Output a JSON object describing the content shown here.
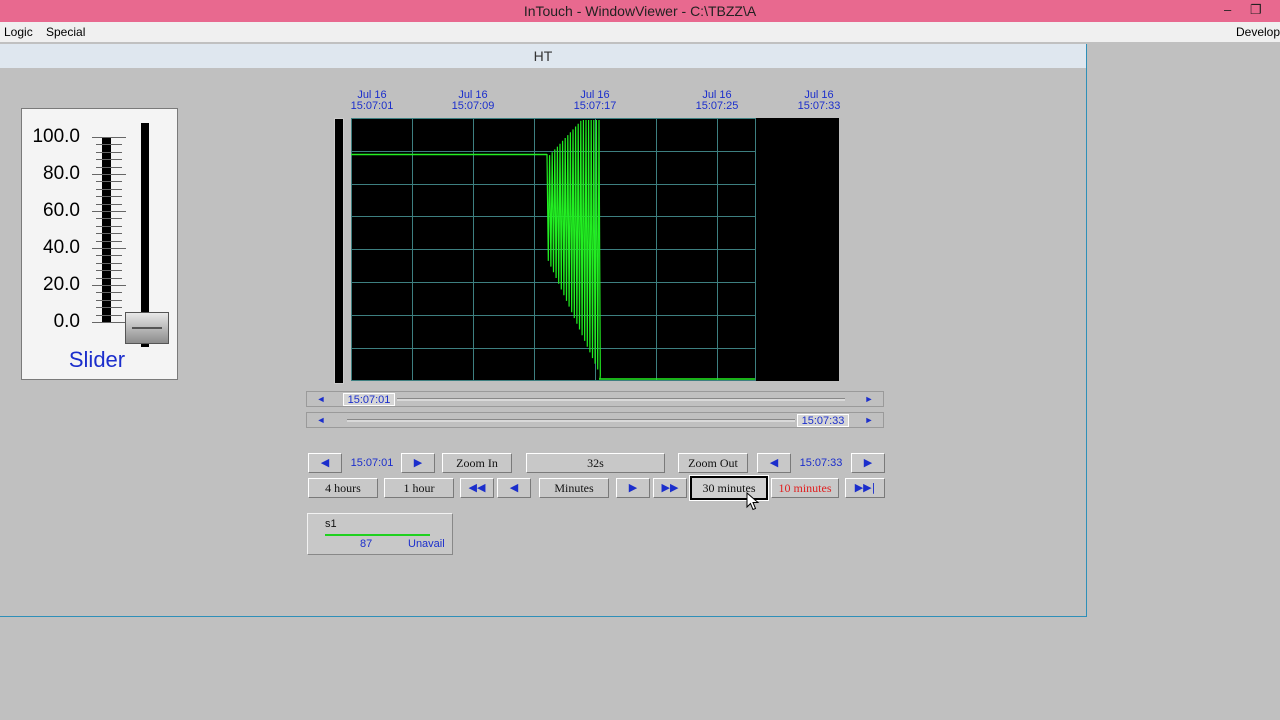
{
  "titlebar": {
    "title": "InTouch - WindowViewer - C:\\TBZZ\\A",
    "minimize_glyph": "–",
    "restore_glyph": "❐"
  },
  "menu": {
    "logic": "Logic",
    "special": "Special",
    "develop": "Develop"
  },
  "window": {
    "caption": "HT"
  },
  "slider": {
    "ticks": [
      "100.0",
      "80.0",
      "60.0",
      "40.0",
      "20.0",
      "0.0"
    ],
    "label": "Slider",
    "value_fraction": 0.0
  },
  "trend": {
    "time_labels": [
      {
        "date": "Jul 16",
        "time": "15:07:01"
      },
      {
        "date": "Jul 16",
        "time": "15:07:09"
      },
      {
        "date": "Jul 16",
        "time": "15:07:17"
      },
      {
        "date": "Jul 16",
        "time": "15:07:25"
      },
      {
        "date": "Jul 16",
        "time": "15:07:33"
      }
    ],
    "pen_color": "#22ee22",
    "grid_color": "#3d7f80",
    "start_scroll_value": "15:07:01",
    "end_scroll_value": "15:07:33",
    "left_arrow": "◄",
    "right_arrow": "►"
  },
  "controls": {
    "start_time": "15:07:01",
    "end_time": "15:07:33",
    "zoom_in": "Zoom In",
    "span": "32s",
    "zoom_out": "Zoom Out",
    "four_hours": "4 hours",
    "one_hour": "1 hour",
    "minutes": "Minutes",
    "thirty_minutes": "30 minutes",
    "ten_minutes": "10 minutes",
    "arrow_left": "◀",
    "arrow_right": "▶",
    "fast_back": "◀◀",
    "fast_forward": "▶▶",
    "to_end": "▶▶|"
  },
  "legend": {
    "tag": "s1",
    "value": "87",
    "status": "Unavail",
    "pen_color": "#1fd11f"
  }
}
